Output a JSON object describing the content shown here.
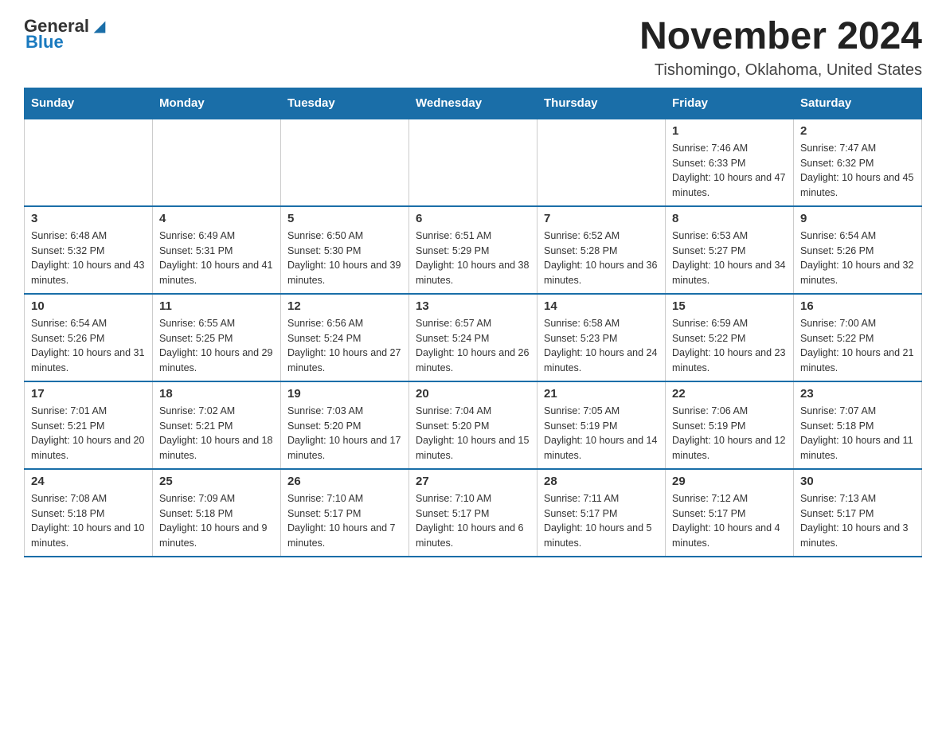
{
  "logo": {
    "text_general": "General",
    "text_blue": "Blue"
  },
  "header": {
    "month_title": "November 2024",
    "location": "Tishomingo, Oklahoma, United States"
  },
  "weekdays": [
    "Sunday",
    "Monday",
    "Tuesday",
    "Wednesday",
    "Thursday",
    "Friday",
    "Saturday"
  ],
  "weeks": [
    [
      {
        "day": "",
        "info": ""
      },
      {
        "day": "",
        "info": ""
      },
      {
        "day": "",
        "info": ""
      },
      {
        "day": "",
        "info": ""
      },
      {
        "day": "",
        "info": ""
      },
      {
        "day": "1",
        "info": "Sunrise: 7:46 AM\nSunset: 6:33 PM\nDaylight: 10 hours and 47 minutes."
      },
      {
        "day": "2",
        "info": "Sunrise: 7:47 AM\nSunset: 6:32 PM\nDaylight: 10 hours and 45 minutes."
      }
    ],
    [
      {
        "day": "3",
        "info": "Sunrise: 6:48 AM\nSunset: 5:32 PM\nDaylight: 10 hours and 43 minutes."
      },
      {
        "day": "4",
        "info": "Sunrise: 6:49 AM\nSunset: 5:31 PM\nDaylight: 10 hours and 41 minutes."
      },
      {
        "day": "5",
        "info": "Sunrise: 6:50 AM\nSunset: 5:30 PM\nDaylight: 10 hours and 39 minutes."
      },
      {
        "day": "6",
        "info": "Sunrise: 6:51 AM\nSunset: 5:29 PM\nDaylight: 10 hours and 38 minutes."
      },
      {
        "day": "7",
        "info": "Sunrise: 6:52 AM\nSunset: 5:28 PM\nDaylight: 10 hours and 36 minutes."
      },
      {
        "day": "8",
        "info": "Sunrise: 6:53 AM\nSunset: 5:27 PM\nDaylight: 10 hours and 34 minutes."
      },
      {
        "day": "9",
        "info": "Sunrise: 6:54 AM\nSunset: 5:26 PM\nDaylight: 10 hours and 32 minutes."
      }
    ],
    [
      {
        "day": "10",
        "info": "Sunrise: 6:54 AM\nSunset: 5:26 PM\nDaylight: 10 hours and 31 minutes."
      },
      {
        "day": "11",
        "info": "Sunrise: 6:55 AM\nSunset: 5:25 PM\nDaylight: 10 hours and 29 minutes."
      },
      {
        "day": "12",
        "info": "Sunrise: 6:56 AM\nSunset: 5:24 PM\nDaylight: 10 hours and 27 minutes."
      },
      {
        "day": "13",
        "info": "Sunrise: 6:57 AM\nSunset: 5:24 PM\nDaylight: 10 hours and 26 minutes."
      },
      {
        "day": "14",
        "info": "Sunrise: 6:58 AM\nSunset: 5:23 PM\nDaylight: 10 hours and 24 minutes."
      },
      {
        "day": "15",
        "info": "Sunrise: 6:59 AM\nSunset: 5:22 PM\nDaylight: 10 hours and 23 minutes."
      },
      {
        "day": "16",
        "info": "Sunrise: 7:00 AM\nSunset: 5:22 PM\nDaylight: 10 hours and 21 minutes."
      }
    ],
    [
      {
        "day": "17",
        "info": "Sunrise: 7:01 AM\nSunset: 5:21 PM\nDaylight: 10 hours and 20 minutes."
      },
      {
        "day": "18",
        "info": "Sunrise: 7:02 AM\nSunset: 5:21 PM\nDaylight: 10 hours and 18 minutes."
      },
      {
        "day": "19",
        "info": "Sunrise: 7:03 AM\nSunset: 5:20 PM\nDaylight: 10 hours and 17 minutes."
      },
      {
        "day": "20",
        "info": "Sunrise: 7:04 AM\nSunset: 5:20 PM\nDaylight: 10 hours and 15 minutes."
      },
      {
        "day": "21",
        "info": "Sunrise: 7:05 AM\nSunset: 5:19 PM\nDaylight: 10 hours and 14 minutes."
      },
      {
        "day": "22",
        "info": "Sunrise: 7:06 AM\nSunset: 5:19 PM\nDaylight: 10 hours and 12 minutes."
      },
      {
        "day": "23",
        "info": "Sunrise: 7:07 AM\nSunset: 5:18 PM\nDaylight: 10 hours and 11 minutes."
      }
    ],
    [
      {
        "day": "24",
        "info": "Sunrise: 7:08 AM\nSunset: 5:18 PM\nDaylight: 10 hours and 10 minutes."
      },
      {
        "day": "25",
        "info": "Sunrise: 7:09 AM\nSunset: 5:18 PM\nDaylight: 10 hours and 9 minutes."
      },
      {
        "day": "26",
        "info": "Sunrise: 7:10 AM\nSunset: 5:17 PM\nDaylight: 10 hours and 7 minutes."
      },
      {
        "day": "27",
        "info": "Sunrise: 7:10 AM\nSunset: 5:17 PM\nDaylight: 10 hours and 6 minutes."
      },
      {
        "day": "28",
        "info": "Sunrise: 7:11 AM\nSunset: 5:17 PM\nDaylight: 10 hours and 5 minutes."
      },
      {
        "day": "29",
        "info": "Sunrise: 7:12 AM\nSunset: 5:17 PM\nDaylight: 10 hours and 4 minutes."
      },
      {
        "day": "30",
        "info": "Sunrise: 7:13 AM\nSunset: 5:17 PM\nDaylight: 10 hours and 3 minutes."
      }
    ]
  ]
}
